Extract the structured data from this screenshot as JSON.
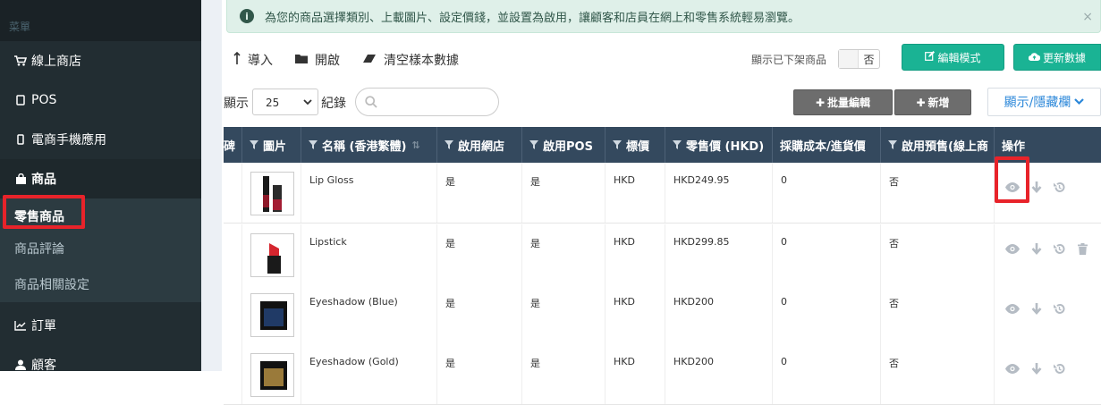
{
  "sidebar": {
    "header": "菜單",
    "items": [
      {
        "label": "線上商店",
        "icon": "cart-icon"
      },
      {
        "label": "POS",
        "icon": "tablet-icon"
      },
      {
        "label": "電商手機應用",
        "icon": "mobile-icon"
      },
      {
        "label": "商品",
        "icon": "bag-icon"
      },
      {
        "label": "訂單",
        "icon": "chart-icon"
      },
      {
        "label": "顧客",
        "icon": "user-icon"
      }
    ],
    "sub_items": [
      {
        "label": "零售商品"
      },
      {
        "label": "商品評論"
      },
      {
        "label": "商品相關設定"
      }
    ]
  },
  "alert": {
    "text": "為您的商品選擇類別、上載圖片、設定價錢，並設置為啟用，讓顧客和店員在網上和零售系統輕易瀏覽。",
    "close": "×"
  },
  "toolbar": {
    "import_label": "導入",
    "open_label": "開啟",
    "clear_label": "清空樣本數據",
    "show_offshelf_label": "顯示已下架商品",
    "show_offshelf_value": "否",
    "edit_mode_label": "編輯模式",
    "update_data_label": "更新數據"
  },
  "list_controls": {
    "show_label": "顯示",
    "page_size": "25",
    "records_label": "紀錄",
    "batch_edit_label": "批量編輯",
    "add_label": "新增",
    "show_hide_cols_label": "顯示/隱藏欄"
  },
  "table": {
    "partial_first_col": "碑",
    "columns": [
      {
        "label": "圖片",
        "filter": true
      },
      {
        "label": "名稱 (香港繁體)",
        "filter": true,
        "sort": true
      },
      {
        "label": "啟用網店",
        "filter": true
      },
      {
        "label": "啟用POS",
        "filter": true
      },
      {
        "label": "標價",
        "filter": true
      },
      {
        "label": "零售價 (HKD)",
        "filter": true
      },
      {
        "label": "採購成本/進貨價",
        "filter": false
      },
      {
        "label": "啟用預售(線上商",
        "filter": true
      },
      {
        "label": "操作",
        "filter": false
      }
    ],
    "rows": [
      {
        "name": "Lip Gloss",
        "online": "是",
        "pos": "是",
        "currency": "HKD",
        "price": "HKD249.95",
        "cost": "0",
        "preorder": "否",
        "thumb": "lip-gloss"
      },
      {
        "name": "Lipstick",
        "online": "是",
        "pos": "是",
        "currency": "HKD",
        "price": "HKD299.85",
        "cost": "0",
        "preorder": "否",
        "thumb": "lipstick"
      },
      {
        "name": "Eyeshadow (Blue)",
        "online": "是",
        "pos": "是",
        "currency": "HKD",
        "price": "HKD200",
        "cost": "0",
        "preorder": "否",
        "thumb": "eyeshadow-blue"
      },
      {
        "name": "Eyeshadow (Gold)",
        "online": "是",
        "pos": "是",
        "currency": "HKD",
        "price": "HKD200",
        "cost": "0",
        "preorder": "否",
        "thumb": "eyeshadow-gold"
      }
    ]
  },
  "colors": {
    "sidebar_bg": "#222d32",
    "table_header": "#34495e",
    "accent_green": "#1ab394",
    "highlight_red": "#e8232a"
  }
}
